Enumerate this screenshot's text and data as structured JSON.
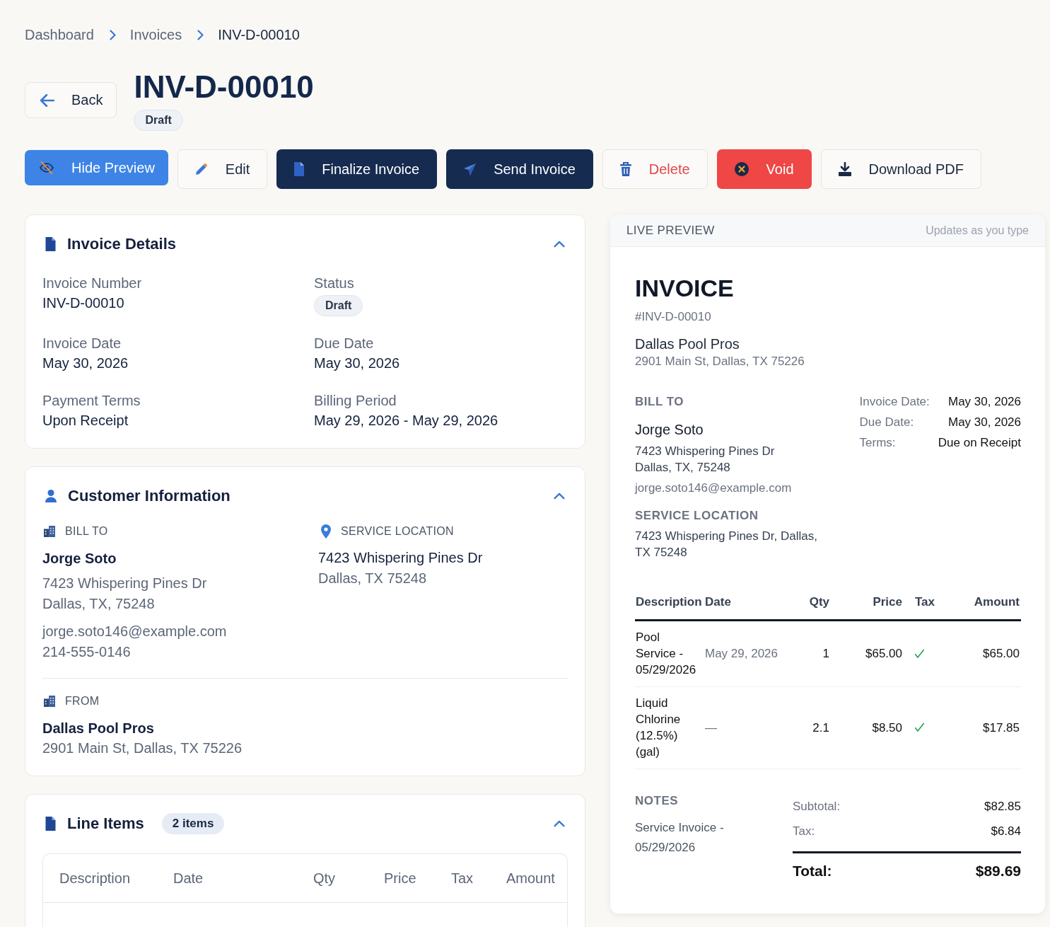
{
  "breadcrumb": [
    {
      "label": "Dashboard",
      "current": false
    },
    {
      "label": "Invoices",
      "current": false
    },
    {
      "label": "INV-D-00010",
      "current": true
    }
  ],
  "header": {
    "back_label": "Back",
    "title": "INV-D-00010",
    "status": "Draft"
  },
  "actions": [
    {
      "label": "Hide Preview",
      "kind": "hide-preview"
    },
    {
      "label": "Edit",
      "kind": "edit"
    },
    {
      "label": "Finalize Invoice",
      "kind": "finalize"
    },
    {
      "label": "Send Invoice",
      "kind": "send"
    },
    {
      "label": "Delete",
      "kind": "delete"
    },
    {
      "label": "Void",
      "kind": "void"
    },
    {
      "label": "Download PDF",
      "kind": "download"
    }
  ],
  "invoice_details": {
    "title": "Invoice Details",
    "expanded": true,
    "fields": [
      {
        "label": "Invoice Number",
        "value": "INV-D-00010",
        "kind": "text"
      },
      {
        "label": "Status",
        "value": "Draft",
        "kind": "badge"
      },
      {
        "label": "Invoice Date",
        "value": "May 30, 2026",
        "kind": "text"
      },
      {
        "label": "Due Date",
        "value": "May 30, 2026",
        "kind": "text"
      },
      {
        "label": "Payment Terms",
        "value": "Upon Receipt",
        "kind": "text"
      },
      {
        "label": "Billing Period",
        "value": "May 29, 2026 - May 29, 2026",
        "kind": "text"
      }
    ]
  },
  "customer_information": {
    "title": "Customer Information",
    "expanded": true,
    "bill_to": {
      "heading": "BILL TO",
      "name": "Jorge Soto",
      "address_lines": [
        "7423 Whispering Pines Dr",
        "Dallas, TX, 75248"
      ],
      "email": "jorge.soto146@example.com",
      "phone": "214-555-0146"
    },
    "service_location": {
      "heading": "SERVICE LOCATION",
      "street": "7423 Whispering Pines Dr",
      "city_line": "Dallas, TX 75248"
    },
    "from": {
      "heading": "FROM",
      "name": "Dallas Pool Pros",
      "address": "2901 Main St, Dallas, TX 75226"
    }
  },
  "line_items": {
    "title": "Line Items",
    "count": "2 items",
    "expanded": true,
    "columns": [
      "Description",
      "Date",
      "Qty",
      "Price",
      "Tax",
      "Amount"
    ]
  },
  "preview": {
    "label": "LIVE PREVIEW",
    "hint": "Updates as you type",
    "heading": "INVOICE",
    "number": "#INV-D-00010",
    "company": {
      "name": "Dallas Pool Pros",
      "address": "2901 Main St, Dallas, TX 75226"
    },
    "bill_to": {
      "heading": "BILL TO",
      "name": "Jorge Soto",
      "address_lines": [
        "7423 Whispering Pines Dr",
        "Dallas, TX, 75248"
      ],
      "email": "jorge.soto146@example.com"
    },
    "service_location": {
      "heading": "SERVICE LOCATION",
      "address": "7423 Whispering Pines Dr, Dallas, TX 75248"
    },
    "meta": [
      {
        "label": "Invoice Date:",
        "value": "May 30, 2026"
      },
      {
        "label": "Due Date:",
        "value": "May 30, 2026"
      },
      {
        "label": "Terms:",
        "value": "Due on Receipt"
      }
    ],
    "table": {
      "columns": [
        "Description",
        "Date",
        "Qty",
        "Price",
        "Tax",
        "Amount"
      ],
      "rows": [
        {
          "description": "Pool Service - 05/29/2026",
          "date": "May 29, 2026",
          "qty": "1",
          "price": "$65.00",
          "taxable": true,
          "amount": "$65.00"
        },
        {
          "description": "Liquid Chlorine (12.5%) (gal)",
          "date": "—",
          "qty": "2.1",
          "price": "$8.50",
          "taxable": true,
          "amount": "$17.85"
        }
      ]
    },
    "notes": {
      "heading": "NOTES",
      "text": "Service Invoice - 05/29/2026"
    },
    "totals": [
      {
        "label": "Subtotal:",
        "value": "$82.85",
        "kind": "subtotal"
      },
      {
        "label": "Tax:",
        "value": "$6.84",
        "kind": "subtotal"
      },
      {
        "label": "Total:",
        "value": "$89.69",
        "kind": "total"
      }
    ]
  }
}
